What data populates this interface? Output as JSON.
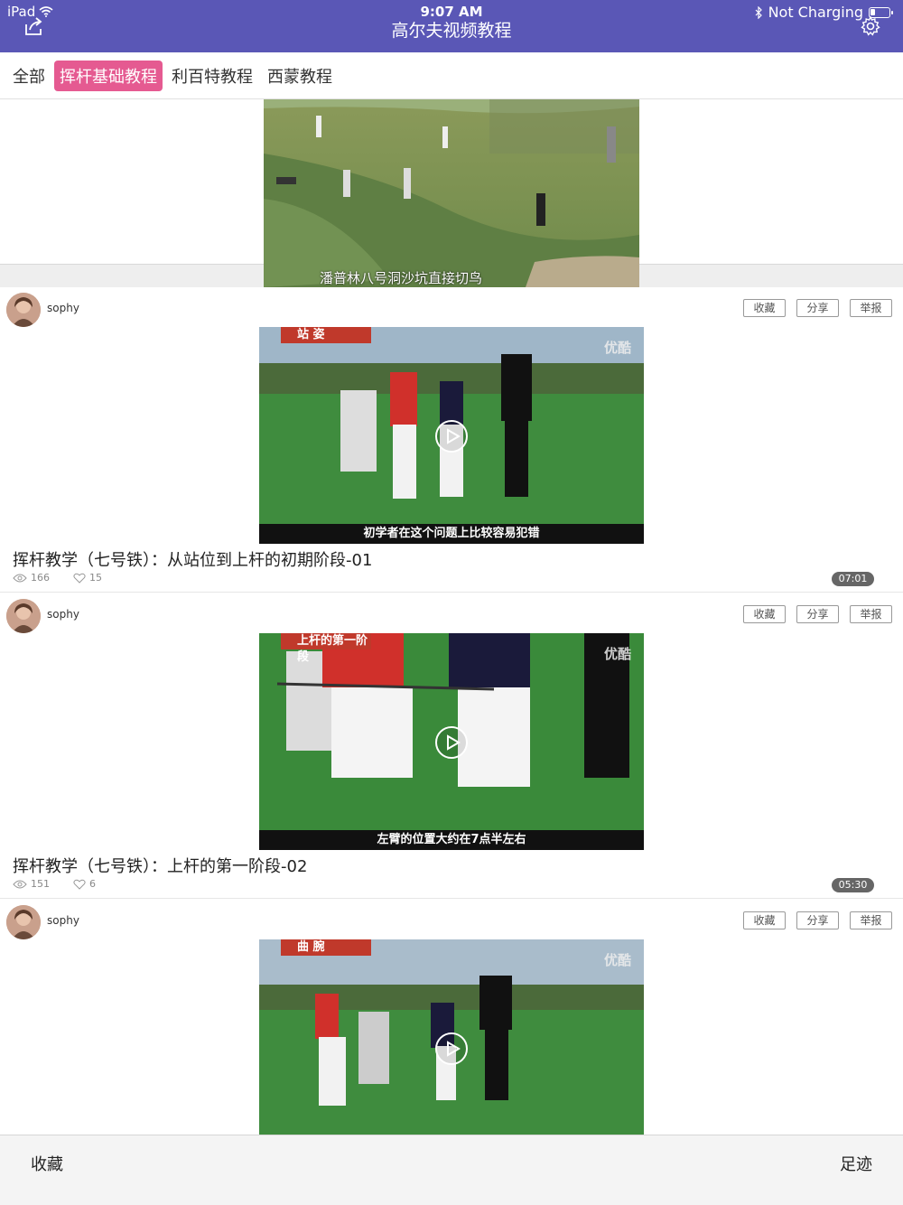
{
  "status": {
    "device": "iPad",
    "time": "9:07 AM",
    "charging": "Not Charging",
    "battery_level": 0.25
  },
  "app_title": "高尔夫视频教程",
  "tabs": [
    {
      "label": "全部",
      "active": false
    },
    {
      "label": "挥杆基础教程",
      "active": true
    },
    {
      "label": "利百特教程",
      "active": false
    },
    {
      "label": "西蒙教程",
      "active": false
    }
  ],
  "featured": {
    "caption": "潘普林八号洞沙坑直接切鸟"
  },
  "actions": {
    "favorite": "收藏",
    "share": "分享",
    "report": "举报"
  },
  "items": [
    {
      "user": "sophy",
      "badge": "站 姿",
      "watermark": "优酷",
      "subtitle": "初学者在这个问题上比较容易犯错",
      "title": "挥杆教学（七号铁）：从站位到上杆的初期阶段-01",
      "views": "166",
      "likes": "15",
      "duration": "07:01"
    },
    {
      "user": "sophy",
      "badge": "上杆的第一阶段",
      "watermark": "优酷",
      "subtitle": "左臂的位置大约在7点半左右",
      "title": "挥杆教学（七号铁）：上杆的第一阶段-02",
      "views": "151",
      "likes": "6",
      "duration": "05:30"
    },
    {
      "user": "sophy",
      "badge": "曲 腕",
      "watermark": "优酷",
      "subtitle": "",
      "title": "",
      "views": "",
      "likes": "",
      "duration": ""
    }
  ],
  "bottom_bar": {
    "left": "收藏",
    "right": "足迹"
  },
  "colors": {
    "header": "#5a57b6",
    "active_tab": "#e55a91"
  }
}
